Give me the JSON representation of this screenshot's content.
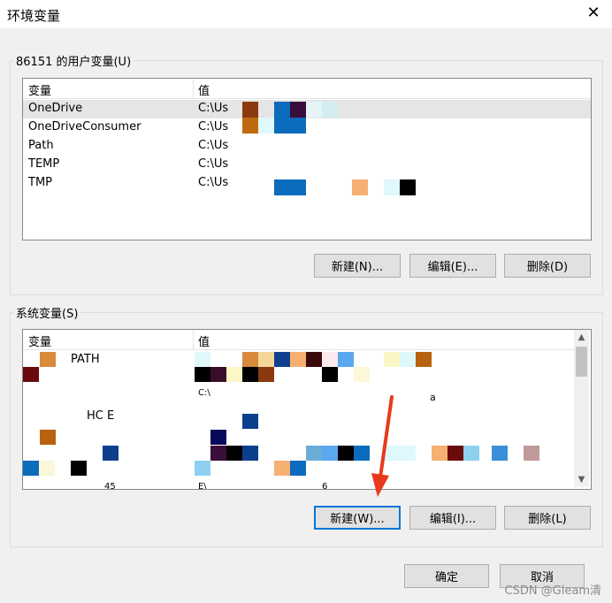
{
  "window": {
    "title": "环境变量",
    "close_label": "✕"
  },
  "user_vars": {
    "legend": "86151 的用户变量(U)",
    "col_name": "变量",
    "col_value": "值",
    "rows": [
      {
        "name": "OneDrive",
        "value": "C:\\Us"
      },
      {
        "name": "OneDriveConsumer",
        "value": "C:\\Us"
      },
      {
        "name": "Path",
        "value": "C:\\Us"
      },
      {
        "name": "TEMP",
        "value": "C:\\Us"
      },
      {
        "name": "TMP",
        "value": "C:\\Us"
      }
    ],
    "new_label": "新建(N)...",
    "edit_label": "编辑(E)...",
    "delete_label": "删除(D)"
  },
  "system_vars": {
    "legend": "系统变量(S)",
    "col_name": "变量",
    "col_value": "值",
    "rows": [
      {
        "name": "PATH",
        "value": ""
      },
      {
        "name": "HC  E",
        "value": ""
      }
    ],
    "fragments": [
      "C:\\",
      "a",
      "6",
      "E\\",
      "45"
    ],
    "new_label": "新建(W)...",
    "edit_label": "编辑(I)...",
    "delete_label": "删除(L)"
  },
  "footer": {
    "ok_label": "确定",
    "cancel_label": "取消"
  },
  "watermark": "CSDN @Gleam清",
  "colors": {
    "selection": "#e5e5e5",
    "default_button_border": "#0078d7",
    "arrow": "#e8391d"
  }
}
